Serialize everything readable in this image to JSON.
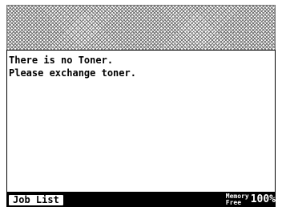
{
  "message": {
    "line1": "There is no Toner.",
    "line2": "Please exchange toner."
  },
  "footer": {
    "job_list_label": "Job List",
    "memory_label_top": "Memory",
    "memory_label_bottom": "Free",
    "memory_value": "100%"
  },
  "colors": {
    "background": "#ffffff",
    "footer_bar": "#000000",
    "text": "#000000"
  }
}
